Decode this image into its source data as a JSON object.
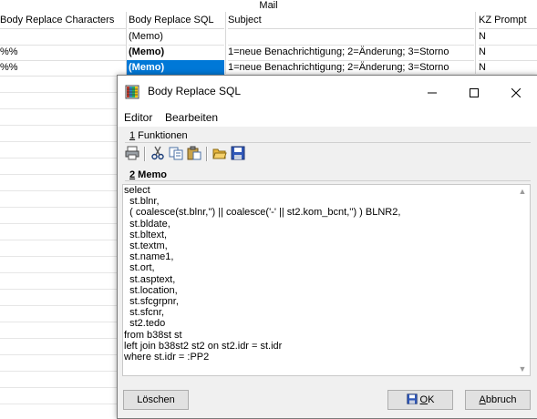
{
  "grid": {
    "title": "Mail",
    "columns": [
      "Body Replace Characters",
      "Body Replace SQL",
      "Subject",
      "KZ Prompt"
    ],
    "rows": [
      {
        "chars": "",
        "sql": "(Memo)",
        "subject": "",
        "prompt": "N"
      },
      {
        "chars": "%%",
        "sql": "(Memo)",
        "subject": "1=neue Benachrichtigung; 2=Änderung; 3=Storno",
        "prompt": "N"
      },
      {
        "chars": "%%",
        "sql": "(Memo)",
        "subject": "1=neue Benachrichtigung; 2=Änderung; 3=Storno",
        "prompt": "N"
      }
    ],
    "selection_color": "#0078d7"
  },
  "dialog": {
    "title": "Body Replace SQL",
    "window_buttons": {
      "minimize": "—",
      "maximize": "☐",
      "close": "✕"
    },
    "menu": [
      "Editor",
      "Bearbeiten"
    ],
    "funktionen_label": {
      "hotkey": "1",
      "rest": " Funktionen"
    },
    "memo_label": {
      "hotkey": "2",
      "rest": " Memo"
    },
    "toolbar_icons": [
      "print-icon",
      "cut-icon",
      "copy-icon",
      "paste-icon",
      "open-folder-icon",
      "save-icon"
    ],
    "memo_text": "select\n  st.blnr,\n  ( coalesce(st.blnr,'') || coalesce('-' || st2.kom_bcnt,'') ) BLNR2,\n  st.bldate,\n  st.bltext,\n  st.textm,\n  st.name1,\n  st.ort,\n  st.asptext,\n  st.location,\n  st.sfcgrpnr,\n  st.sfcnr,\n  st2.tedo\nfrom b38st st\nleft join b38st2 st2 on st2.idr = st.idr\nwhere st.idr = :PP2",
    "buttons": {
      "delete": "Löschen",
      "ok": "OK",
      "cancel": "Abbruch"
    },
    "ok_hotkey": "O",
    "ok_rest": "K",
    "cancel_hotkey": "A",
    "cancel_rest": "bbruch"
  }
}
